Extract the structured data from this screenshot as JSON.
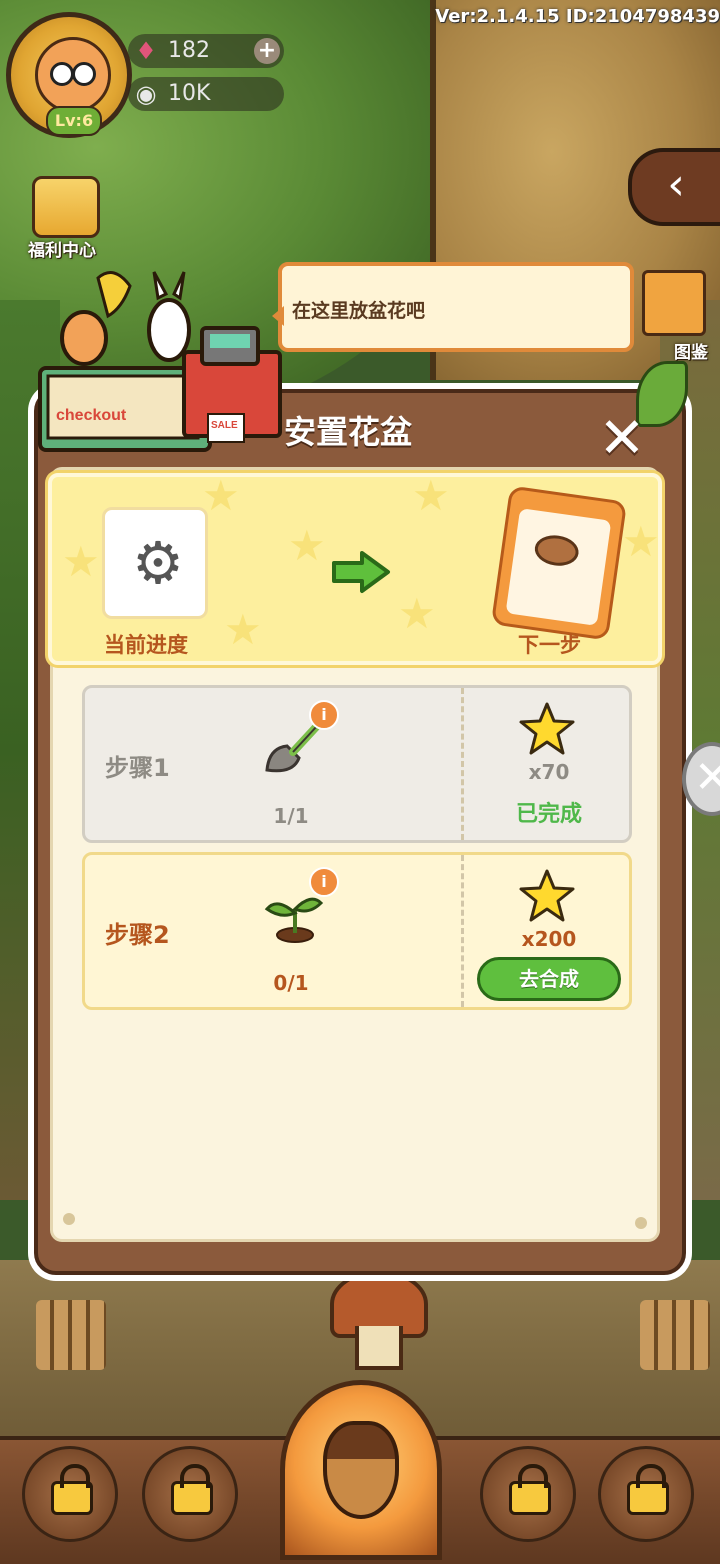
{
  "hud": {
    "version": "Ver:2.1.4.15 ID:2104798439",
    "level": "Lv:6",
    "gems": "182",
    "coins": "10K",
    "welfare_label": "福利中心",
    "atlas_label": "图鉴"
  },
  "tooltip": {
    "text": "在这里放盆花吧"
  },
  "shop": {
    "checkout_label": "checkout",
    "sale_label": "SALE"
  },
  "dialog": {
    "title": "安置花盆",
    "progress": {
      "current_label": "当前进度",
      "next_label": "下一步"
    },
    "steps": [
      {
        "name": "步骤1",
        "count": "1/1",
        "reward": "x70",
        "status": "已完成"
      },
      {
        "name": "步骤2",
        "count": "0/1",
        "reward": "x200",
        "button_label": "去合成"
      }
    ]
  },
  "icons": {
    "close": "close-icon",
    "gear": "gear-icon",
    "arrow": "arrow-right-icon",
    "pot": "flower-pot-icon",
    "trowel": "trowel-icon",
    "sprout": "sprout-icon",
    "star": "star-icon",
    "lock": "lock-icon",
    "acorn": "acorn-icon"
  },
  "colors": {
    "dialog_frame": "#8b5a3c",
    "accent_orange": "#b5561e",
    "done_green": "#4fb84a",
    "button_green": "#5fbf3e"
  }
}
